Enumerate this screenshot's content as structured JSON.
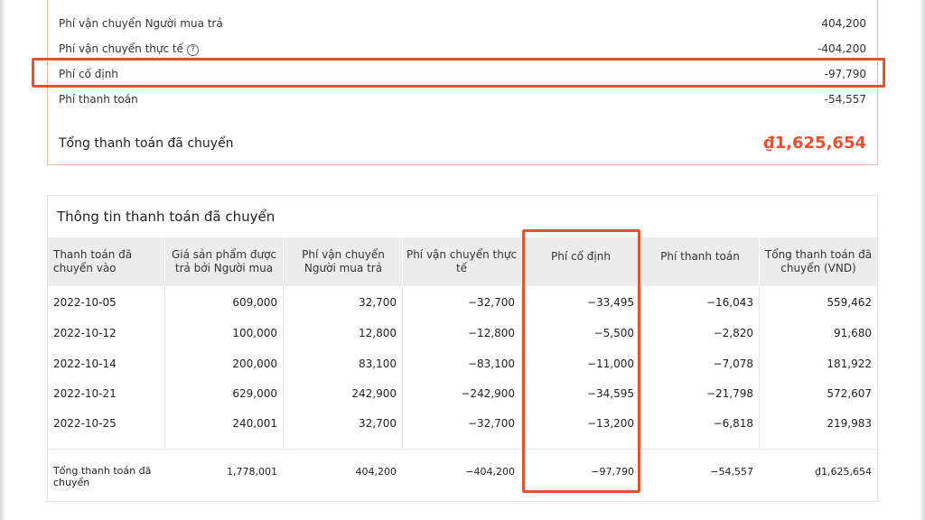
{
  "summary": {
    "rows": [
      {
        "label": "Phí vận chuyển Người mua trả",
        "value": "404,200"
      },
      {
        "label": "Phí vận chuyển thực tế",
        "value": "-404,200",
        "info_icon": "info-icon"
      },
      {
        "label": "Phí cố định",
        "value": "-97,790"
      },
      {
        "label": "Phí thanh toán",
        "value": "-54,557"
      }
    ],
    "total_label": "Tổng thanh toán đã chuyển",
    "total_value": "₫1,625,654",
    "info_glyph": "?"
  },
  "details": {
    "title": "Thông tin thanh toán đã chuyển",
    "headers": [
      "Thanh toán đã chuyển vào",
      "Giá sản phẩm được trả bởi Người mua",
      "Phí vận chuyển Người mua trả",
      "Phí vận chuyển thực tế",
      "Phí cố định",
      "Phí thanh toán",
      "Tổng thanh toán đã chuyển (VND)"
    ],
    "rows": [
      [
        "2022-10-05",
        "609,000",
        "32,700",
        "−32,700",
        "−33,495",
        "−16,043",
        "559,462"
      ],
      [
        "2022-10-12",
        "100,000",
        "12,800",
        "−12,800",
        "−5,500",
        "−2,820",
        "91,680"
      ],
      [
        "2022-10-14",
        "200,000",
        "83,100",
        "−83,100",
        "−11,000",
        "−7,078",
        "181,922"
      ],
      [
        "2022-10-21",
        "629,000",
        "242,900",
        "−242,900",
        "−34,595",
        "−21,798",
        "572,607"
      ],
      [
        "2022-10-25",
        "240,001",
        "32,700",
        "−32,700",
        "−13,200",
        "−6,818",
        "219,983"
      ]
    ],
    "footer": [
      "Tổng thanh toán đã chuyển",
      "1,778,001",
      "404,200",
      "−404,200",
      "−97,790",
      "−54,557",
      "₫1,625,654"
    ]
  },
  "colors": {
    "accent": "#ee4d2d",
    "highlight": "#e4542b",
    "header_bg": "#ececec"
  }
}
